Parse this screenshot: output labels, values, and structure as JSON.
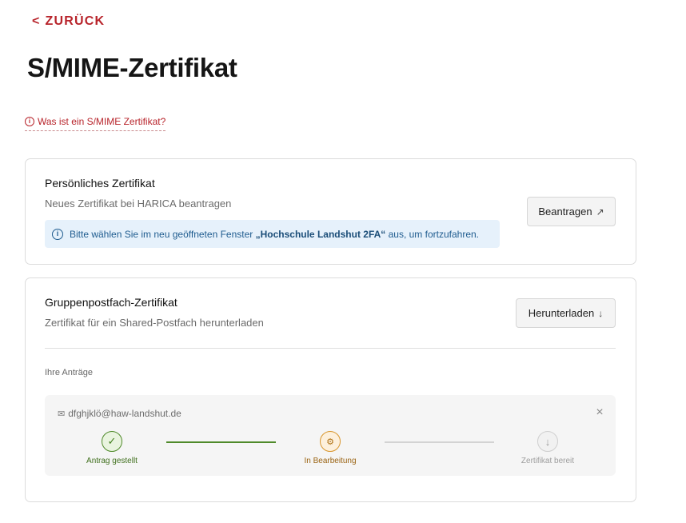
{
  "nav": {
    "back_label": "ZURÜCK",
    "back_icon": "chevron-left-icon"
  },
  "page": {
    "title": "S/MIME-Zertifikat"
  },
  "info_link": {
    "label": "Was ist ein S/MIME Zertifikat?",
    "icon": "info-icon"
  },
  "personal_cert": {
    "title": "Persönliches Zertifikat",
    "subtitle": "Neues Zertifikat bei HARICA beantragen",
    "notice_before": "Bitte wählen Sie im neu geöffneten Fenster ",
    "notice_bold": "„Hochschule Landshut 2FA“",
    "notice_after": " aus, um fortzufahren.",
    "button_label": "Beantragen",
    "button_icon": "external-link-icon"
  },
  "group_cert": {
    "title": "Gruppenpostfach-Zertifikat",
    "subtitle": "Zertifikat für ein Shared-Postfach herunterladen",
    "button_label": "Herunterladen",
    "button_icon": "download-icon",
    "requests_label": "Ihre Anträge",
    "request": {
      "email": "dfghjklö@haw-landshut.de",
      "steps": [
        {
          "label": "Antrag gestellt",
          "status": "done"
        },
        {
          "label": "In Bearbeitung",
          "status": "active"
        },
        {
          "label": "Zertifikat bereit",
          "status": "pending"
        }
      ]
    }
  },
  "colors": {
    "accent": "#b8242b",
    "notice_bg": "#e6f1fb",
    "done": "#4f8a2a",
    "active": "#d9962e"
  }
}
